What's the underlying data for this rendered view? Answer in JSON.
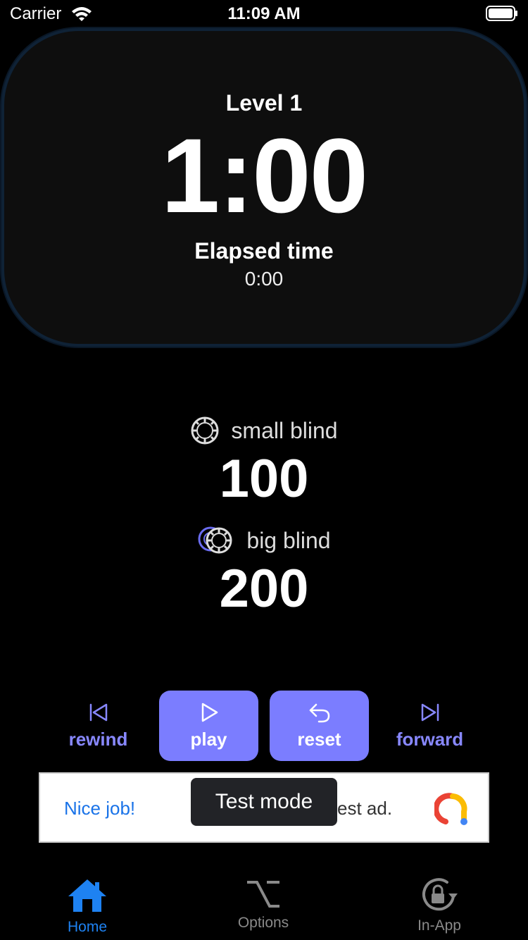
{
  "status_bar": {
    "carrier": "Carrier",
    "time": "11:09 AM"
  },
  "timer": {
    "level": "Level 1",
    "countdown": "1:00",
    "elapsed_label": "Elapsed time",
    "elapsed_value": "0:00"
  },
  "blinds": {
    "small_label": "small blind",
    "small_value": "100",
    "big_label": "big blind",
    "big_value": "200"
  },
  "controls": {
    "rewind": "rewind",
    "play": "play",
    "reset": "reset",
    "forward": "forward"
  },
  "ad": {
    "left_text": "Nice job!",
    "right_text": "est ad.",
    "toast": "Test mode"
  },
  "tabs": [
    {
      "label": "Home",
      "icon": "home-icon",
      "active": true
    },
    {
      "label": "Options",
      "icon": "option-key-icon",
      "active": false
    },
    {
      "label": "In-App",
      "icon": "lock-rotate-icon",
      "active": false
    }
  ],
  "colors": {
    "accent": "#7b7dff",
    "tab_active": "#1e82f2",
    "tab_inactive": "#8a8a8a",
    "card_border": "#0f2236"
  }
}
